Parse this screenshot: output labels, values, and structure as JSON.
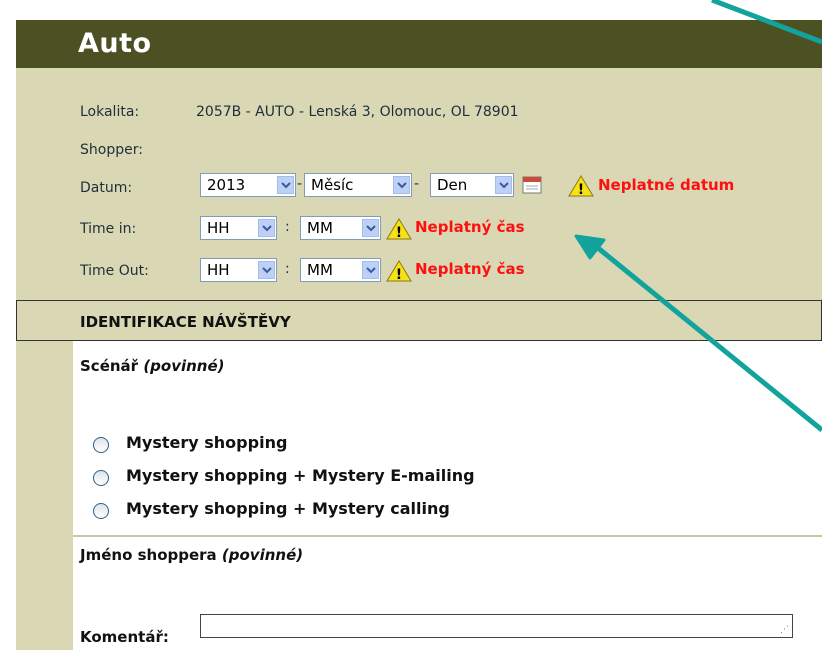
{
  "header": {
    "title": "Auto"
  },
  "info": {
    "location_label": "Lokalita:",
    "location_value": "2057B - AUTO  - Lenská 3, Olomouc, OL 78901",
    "shopper_label": "Shopper:",
    "date_label": "Datum:",
    "date": {
      "year": "2013",
      "month": "Měsíc",
      "day": "Den",
      "sep1": "-",
      "sep2": "-"
    },
    "date_warning": "Neplatné datum",
    "time_in_label": "Time in:",
    "time_in": {
      "hour": "HH",
      "minute": "MM",
      "sep": ":"
    },
    "time_in_warning": "Neplatný čas",
    "time_out_label": "Time Out:",
    "time_out": {
      "hour": "HH",
      "minute": "MM",
      "sep": ":"
    },
    "time_out_warning": "Neplatný čas"
  },
  "section": {
    "title": "IDENTIFIKACE NÁVŠTĚVY"
  },
  "scenario": {
    "label": "Scénář",
    "required": "(povinné)",
    "options": [
      "Mystery shopping",
      "Mystery shopping + Mystery E-mailing",
      "Mystery shopping + Mystery calling"
    ]
  },
  "shopper_name": {
    "label": "Jméno shoppera",
    "required": "(povinné)"
  },
  "comment": {
    "label": "Komentář:"
  },
  "colors": {
    "header_bg": "#4c5123",
    "panel_bg": "#d9d7b4",
    "warning": "#ff1010",
    "arrow": "#12a39c"
  },
  "icons": [
    "dropdown-arrow-icon",
    "calendar-icon",
    "warning-icon",
    "annotation-arrow"
  ]
}
